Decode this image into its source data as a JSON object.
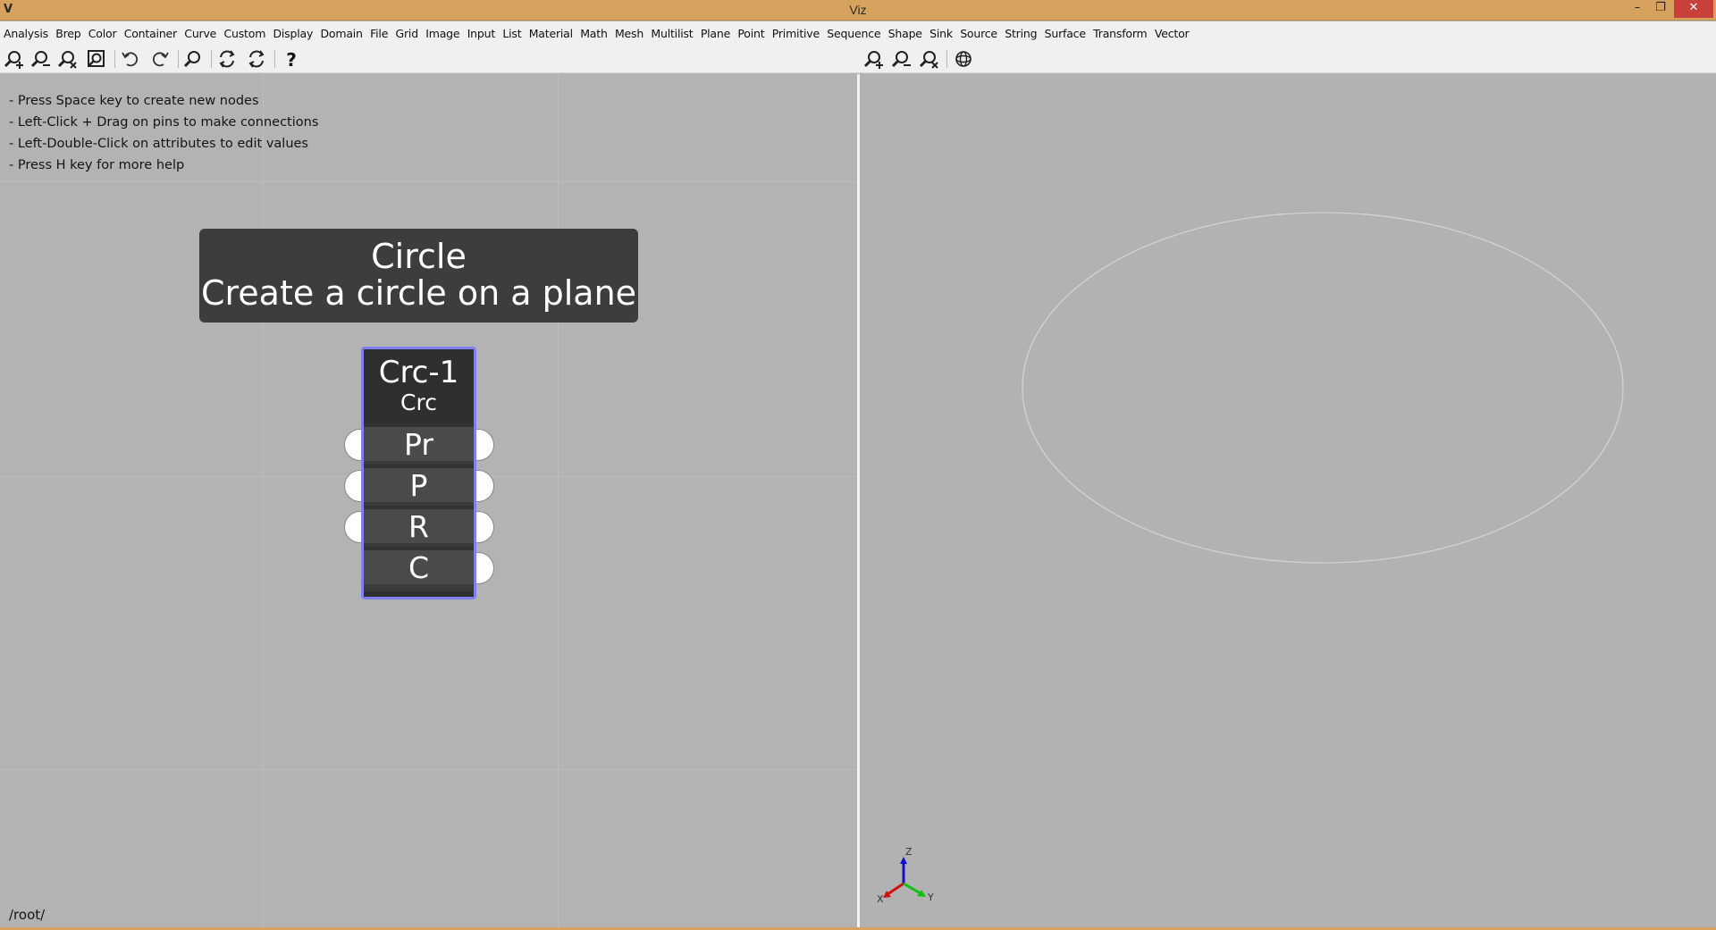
{
  "window": {
    "title": "Viz",
    "logo_text": "V",
    "minimize_glyph": "–",
    "maximize_glyph": "❐",
    "close_glyph": "✕"
  },
  "menu": [
    "Analysis",
    "Brep",
    "Color",
    "Container",
    "Curve",
    "Custom",
    "Display",
    "Domain",
    "File",
    "Grid",
    "Image",
    "Input",
    "List",
    "Material",
    "Math",
    "Mesh",
    "Multilist",
    "Plane",
    "Point",
    "Primitive",
    "Sequence",
    "Shape",
    "Sink",
    "Source",
    "String",
    "Surface",
    "Transform",
    "Vector"
  ],
  "toolbar_left": [
    "zoom-in-icon",
    "zoom-out-icon",
    "zoom-reset-icon",
    "zoom-extents-icon",
    "undo-icon",
    "redo-icon",
    "find-icon",
    "refresh-all-icon",
    "refresh-icon",
    "help-icon"
  ],
  "toolbar_right": [
    "viewport-zoom-in-icon",
    "viewport-zoom-out-icon",
    "viewport-zoom-reset-icon",
    "viewport-orbit-icon"
  ],
  "help": {
    "lines": [
      "- Press Space key to create new nodes",
      "- Left-Click + Drag on pins to make connections",
      "- Left-Double-Click on attributes to edit values",
      "- Press H key for more help"
    ]
  },
  "tooltip": {
    "title": "Circle",
    "description": "Create a circle on a plane"
  },
  "node": {
    "name": "Crc-1",
    "type": "Crc",
    "pins": [
      "Pr",
      "P",
      "R",
      "C"
    ],
    "accent_color": "#7f7ff0"
  },
  "path": "/root/",
  "axes": {
    "z_label": "Z",
    "x_label": "X",
    "y_label": "Y",
    "z_color": "#1010d0",
    "x_color": "#d01010",
    "y_color": "#10c010"
  }
}
